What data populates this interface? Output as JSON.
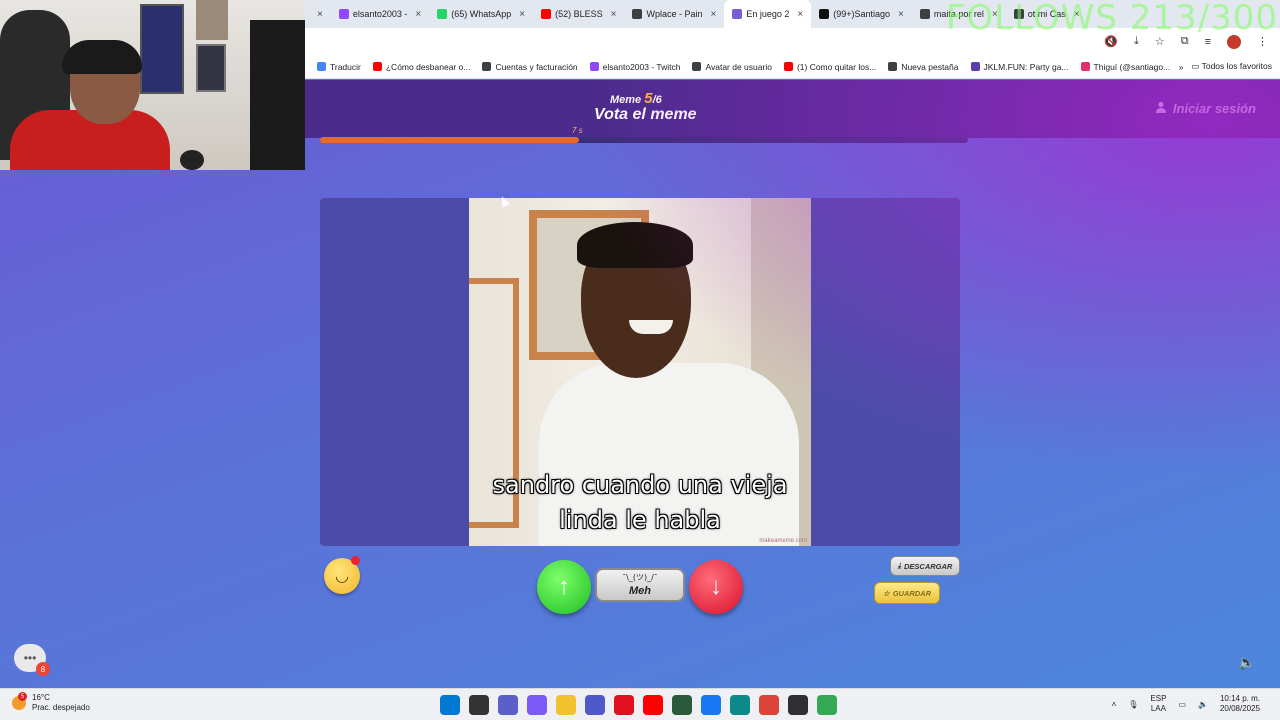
{
  "overlay": {
    "follows_text": "FOLLOWS 213/300"
  },
  "browser": {
    "tabs": [
      {
        "label": "",
        "color": "#5a5a5a"
      },
      {
        "label": "elsanto2003 -",
        "color": "#9146ff"
      },
      {
        "label": "(65) WhatsApp",
        "color": "#25d366"
      },
      {
        "label": "(52) BLESS",
        "color": "#ff0000"
      },
      {
        "label": "Wplace - Pain",
        "color": "#3c4043"
      },
      {
        "label": "En juego 2",
        "color": "#7b5bd6",
        "active": true
      },
      {
        "label": "(99+)Santiago",
        "color": "#111111"
      },
      {
        "label": "maita por rel",
        "color": "#3c4043"
      },
      {
        "label": "ot mi Cas",
        "color": "#3c4043"
      }
    ],
    "bookmarks": [
      {
        "label": "Traducir",
        "color": "#4285f4"
      },
      {
        "label": "¿Cómo desbanear o...",
        "color": "#ff0000"
      },
      {
        "label": "Cuentas y facturación",
        "color": "#3c4043"
      },
      {
        "label": "elsanto2003 - Twitch",
        "color": "#9146ff"
      },
      {
        "label": "Avatar de usuario",
        "color": "#3c4043"
      },
      {
        "label": "(1) Como quitar los...",
        "color": "#ff0000"
      },
      {
        "label": "Nueva pestaña",
        "color": "#3c4043"
      },
      {
        "label": "JKLM.FUN: Party ga...",
        "color": "#5a3db0"
      },
      {
        "label": "Thiguí (@santiago...",
        "color": "#e1306c"
      }
    ],
    "all_bookmarks": "Todos los favoritos"
  },
  "game": {
    "meme_prefix": "Meme",
    "meme_current": "5",
    "meme_total": "/6",
    "title": "Vota el meme",
    "login": "Iniciar sesión",
    "timer": "7 s",
    "progress": 0.4,
    "caption_line1": "sandro cuando una vieja",
    "caption_line2": "linda le habla",
    "watermark": "makeameme.com",
    "meh_face": "¯\\_(ツ)_/¯",
    "meh_label": "Meh",
    "download_label": "DESCARGAR",
    "save_label": "GUARDAR",
    "chat_badge": "8"
  },
  "taskbar": {
    "weather_temp": "16°C",
    "weather_desc": "Prac. despejado",
    "weather_badge": "5",
    "apps": [
      {
        "name": "windows-start",
        "color": "#0078d4"
      },
      {
        "name": "task-view",
        "color": "#333333"
      },
      {
        "name": "chat",
        "color": "#5b5fc7"
      },
      {
        "name": "copilot",
        "color": "#7a5af8"
      },
      {
        "name": "file-explorer",
        "color": "#f2c12e"
      },
      {
        "name": "teams",
        "color": "#5059c9"
      },
      {
        "name": "opera",
        "color": "#e0101f"
      },
      {
        "name": "youtube",
        "color": "#ff0000"
      },
      {
        "name": "calculator",
        "color": "#2a5a3a"
      },
      {
        "name": "facebook",
        "color": "#1877f2"
      },
      {
        "name": "edge",
        "color": "#0c8a8a"
      },
      {
        "name": "chrome",
        "color": "#db4437"
      },
      {
        "name": "obs",
        "color": "#302e31"
      },
      {
        "name": "chrome-alt",
        "color": "#34a853"
      }
    ],
    "lang_line1": "ESP",
    "lang_line2": "LAA",
    "time": "10:14 p. m.",
    "date": "20/08/2025"
  }
}
